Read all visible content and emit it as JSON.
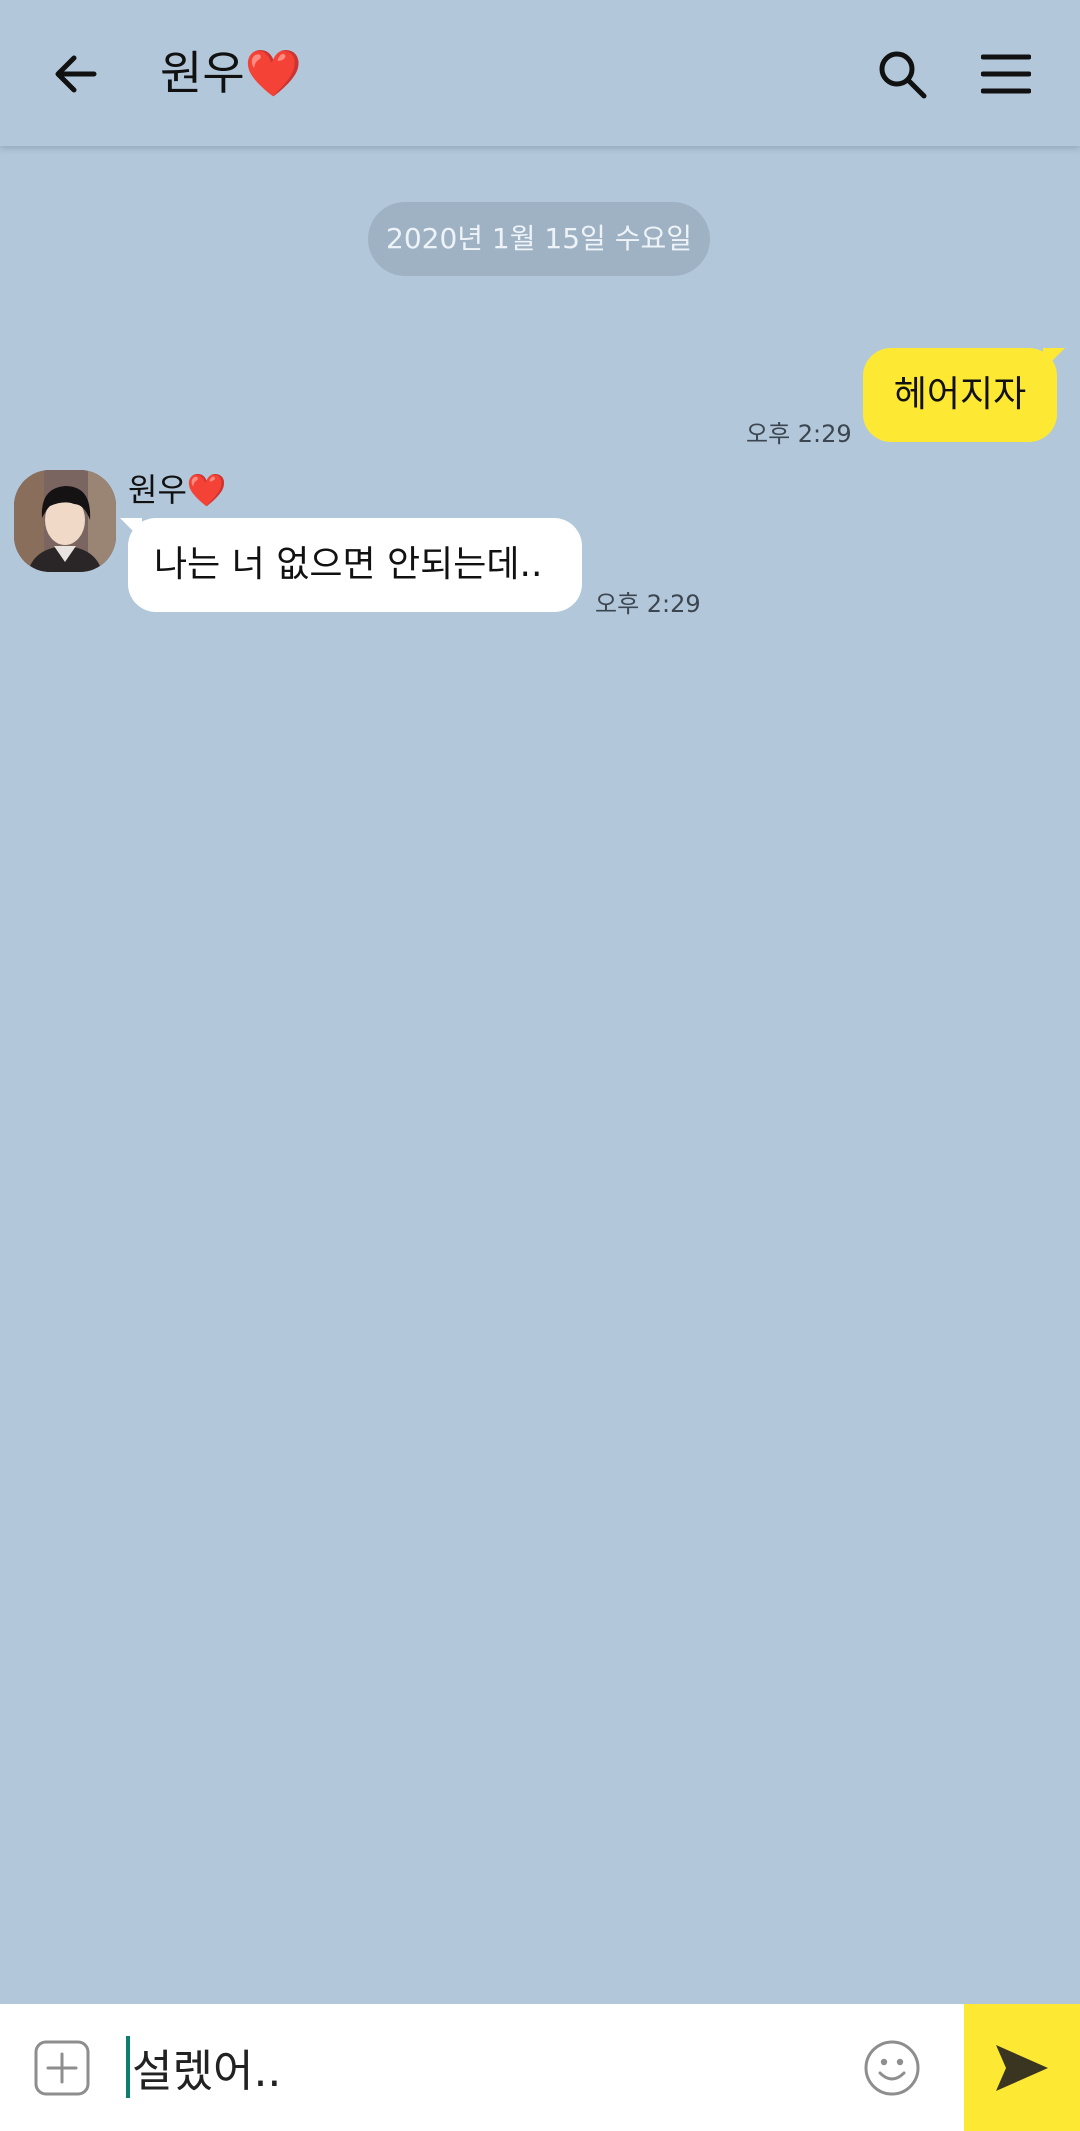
{
  "header": {
    "title": "원우",
    "title_heart": "❤️",
    "back_icon": "arrow-left-icon",
    "search_icon": "search-icon",
    "menu_icon": "hamburger-menu-icon"
  },
  "chat": {
    "date_divider": "2020년 1월 15일 수요일",
    "messages": [
      {
        "sender": "me",
        "text": "헤어지자",
        "time": "오후 2:29",
        "bubble_color": "#fde933"
      },
      {
        "sender": "원우",
        "sender_heart": "❤️",
        "text": "나는 너 없으면 안되는데..",
        "time": "오후 2:29",
        "bubble_color": "#ffffff"
      }
    ]
  },
  "input_bar": {
    "value": "설렜어..",
    "plus_icon": "plus-square-icon",
    "emoji_icon": "smiley-icon",
    "send_icon": "send-arrow-icon",
    "send_color": "#fde933"
  },
  "colors": {
    "background": "#b2c7da",
    "my_bubble": "#fde933",
    "other_bubble": "#ffffff",
    "accent_caret": "#0d7f6e"
  }
}
